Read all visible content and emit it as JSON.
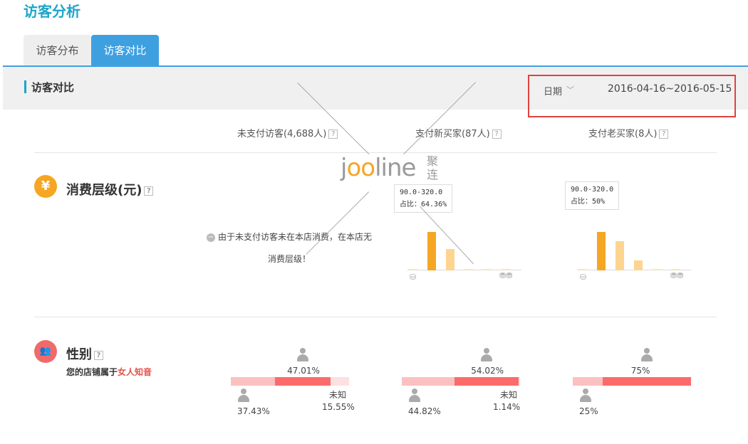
{
  "page": {
    "title": "访客分析"
  },
  "tabs": [
    {
      "label": "访客分布",
      "active": false
    },
    {
      "label": "访客对比",
      "active": true
    }
  ],
  "section": {
    "title": "访客对比"
  },
  "date_filter": {
    "label": "日期",
    "value": "2016-04-16~2016-05-15"
  },
  "columns": [
    {
      "label": "未支付访客(4,688人)"
    },
    {
      "label": "支付新买家(87人)"
    },
    {
      "label": "支付老买家(8人)"
    }
  ],
  "help_icon": "?",
  "watermark": {
    "pre": "j",
    "oo": "oo",
    "post": "line",
    "cn": "聚连"
  },
  "consumption": {
    "icon": "¥",
    "title": "消费层级(元)",
    "unpaid_note_line1": "由于未支付访客未在本店消费，在本店无",
    "unpaid_note_line2": "消费层级！",
    "new_tooltip": {
      "range": "90.0-320.0",
      "ratio": "占比：64.36%"
    },
    "old_tooltip": {
      "range": "90.0-320.0",
      "ratio": "占比：50%"
    },
    "new_bars": [
      0.02,
      0.64,
      0.36,
      0.02,
      0.02,
      0.02
    ],
    "old_bars": [
      0.02,
      0.5,
      0.38,
      0.13,
      0.02,
      0.02
    ],
    "colors": {
      "highlight": "#f5a623",
      "normal": "#fdd490",
      "base": "#f5e3c2"
    }
  },
  "gender": {
    "title": "性别",
    "shop_prefix": "您的店铺属于",
    "shop_type": "女人知音",
    "unknown_label": "未知",
    "groups": [
      {
        "female": 47.01,
        "male": 37.43,
        "unknown": 15.55,
        "female_label": "47.01%",
        "male_label": "37.43%",
        "unknown_label": "15.55%"
      },
      {
        "female": 54.02,
        "male": 44.82,
        "unknown": 1.14,
        "female_label": "54.02%",
        "male_label": "44.82%",
        "unknown_label": "1.14%"
      },
      {
        "female": 75,
        "male": 25,
        "unknown": 0,
        "female_label": "75%",
        "male_label": "25%",
        "unknown_label": ""
      }
    ],
    "colors": {
      "female": "#fb6b6b",
      "male": "#fbc1c1",
      "unknown": "#fde0e0"
    }
  },
  "colors": {
    "accent": "#3fa0e0",
    "title": "#1ea5c9",
    "highlight_box": "#e0433d"
  }
}
